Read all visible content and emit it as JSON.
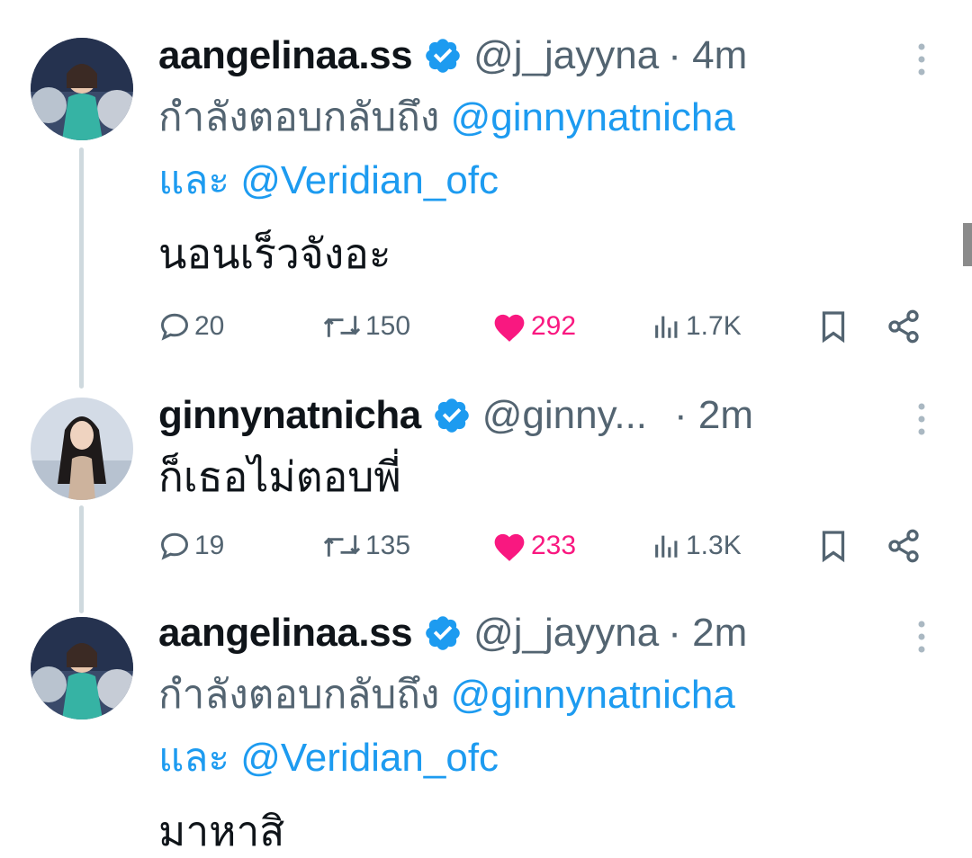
{
  "tweets": [
    {
      "display_name": "aangelinaa.ss",
      "handle": "@j_jayyna",
      "time": "· 4m",
      "replying_prefix": "กำลังตอบกลับถึง",
      "mention_1": "@ginnynatnicha",
      "conjunction": "และ",
      "mention_2": "@Veridian_ofc",
      "text": "นอนเร็วจังอะ",
      "replies": "20",
      "retweets": "150",
      "likes": "292",
      "views": "1.7K"
    },
    {
      "display_name": "ginnynatnicha",
      "handle": "@ginny...",
      "time": "· 2m",
      "text": "ก็เธอไม่ตอบพี่",
      "replies": "19",
      "retweets": "135",
      "likes": "233",
      "views": "1.3K"
    },
    {
      "display_name": "aangelinaa.ss",
      "handle": "@j_jayyna",
      "time": "· 2m",
      "replying_prefix": "กำลังตอบกลับถึง",
      "mention_1": "@ginnynatnicha",
      "conjunction": "และ",
      "mention_2": "@Veridian_ofc",
      "text": "มาหาสิ"
    }
  ],
  "colors": {
    "accent_blue": "#1d9bf0",
    "like_pink": "#f91880",
    "secondary_text": "#536471",
    "primary_text": "#0f1419",
    "thread_line": "#cfd9de"
  },
  "icons": {
    "verified": "verified-badge-icon",
    "more": "more-vertical-icon",
    "reply": "reply-bubble-icon",
    "retweet": "retweet-icon",
    "like": "heart-icon",
    "views": "views-chart-icon",
    "bookmark": "bookmark-icon",
    "share": "share-icon"
  }
}
